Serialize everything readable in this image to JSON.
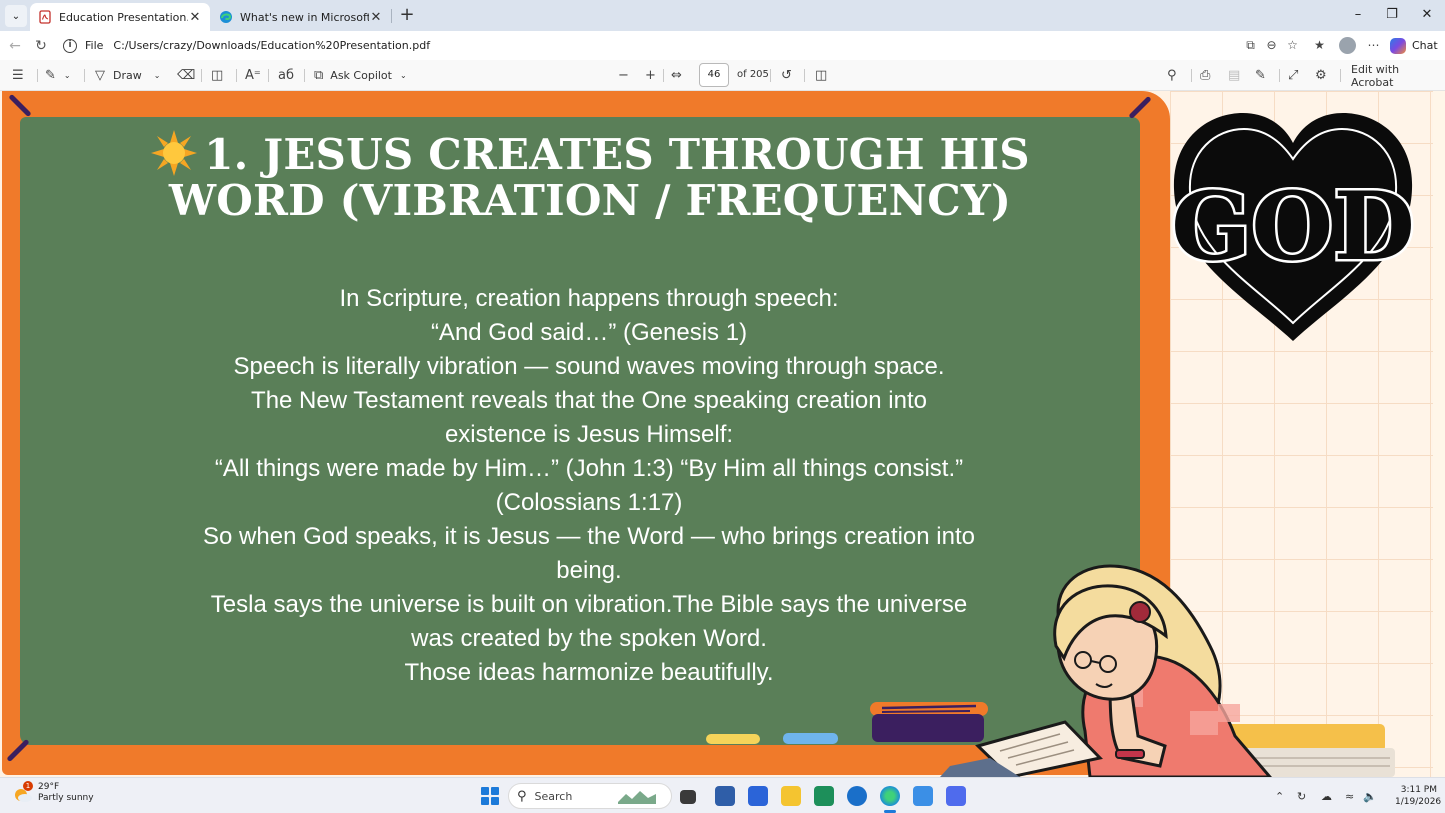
{
  "browser": {
    "tabs": [
      {
        "title": "Education Presentation.pdf",
        "active": true
      },
      {
        "title": "What's new in Microsoft Edge",
        "active": false
      }
    ],
    "address": {
      "scheme": "File",
      "url": "C:/Users/crazy/Downloads/Education%20Presentation.pdf"
    },
    "chat_label": "Chat"
  },
  "pdf_toolbar": {
    "draw_label": "Draw",
    "copilot_label": "Ask Copilot",
    "page_current": "46",
    "page_total": "of 205",
    "edit_label": "Edit with Acrobat"
  },
  "slide": {
    "title": "1. JESUS CREATES THROUGH HIS WORD (VIBRATION / FREQUENCY)",
    "body_lines": [
      "In Scripture, creation happens through speech:",
      "“And God said…” (Genesis 1)",
      "Speech is literally vibration — sound waves moving through space.",
      "The New Testament reveals that the One speaking creation into existence is Jesus Himself:",
      "“All things were made by Him…” (John 1:3) “By Him all things consist.” (Colossians 1:17)",
      "So when God speaks, it is Jesus — the Word — who brings creation into being.",
      "Tesla says the universe is built on vibration.The Bible says the universe was created by the spoken Word.",
      "Those ideas harmonize beautifully."
    ],
    "logo_text": "GOD",
    "colors": {
      "board": "#5a7f58",
      "frame": "#f07a2a"
    }
  },
  "taskbar": {
    "weather_temp": "29°F",
    "weather_desc": "Partly sunny",
    "weather_badge": "1",
    "search_label": "Search",
    "time": "3:11 PM",
    "date": "1/19/2026"
  }
}
